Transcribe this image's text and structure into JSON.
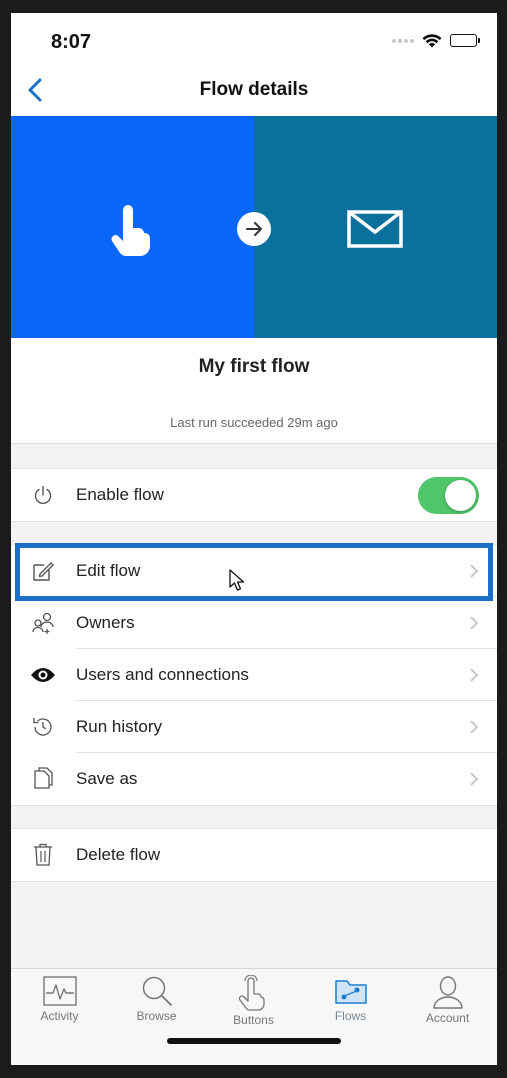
{
  "status_bar": {
    "time": "8:07"
  },
  "nav": {
    "title": "Flow details"
  },
  "hero": {
    "trigger_icon": "touch-icon",
    "action_icon": "mail-icon",
    "left_color": "#0a66f9",
    "right_color": "#0b709c"
  },
  "flow": {
    "name": "My first flow",
    "last_run": "Last run succeeded 29m ago"
  },
  "settings": {
    "enable_label": "Enable flow",
    "enable_on": true
  },
  "menu": [
    {
      "label": "Edit flow",
      "icon": "edit-icon"
    },
    {
      "label": "Owners",
      "icon": "owners-icon"
    },
    {
      "label": "Users and connections",
      "icon": "eye-icon"
    },
    {
      "label": "Run history",
      "icon": "history-icon"
    },
    {
      "label": "Save as",
      "icon": "copy-icon"
    }
  ],
  "danger": {
    "delete_label": "Delete flow"
  },
  "tabs": [
    {
      "label": "Activity",
      "icon": "activity-icon"
    },
    {
      "label": "Browse",
      "icon": "search-icon"
    },
    {
      "label": "Buttons",
      "icon": "touch-icon"
    },
    {
      "label": "Flows",
      "icon": "flows-icon",
      "active": true
    },
    {
      "label": "Account",
      "icon": "account-icon"
    }
  ],
  "colors": {
    "highlight": "#1a6fc6",
    "toggle_on": "#4fc66a",
    "back_arrow": "#1a6fc6"
  }
}
